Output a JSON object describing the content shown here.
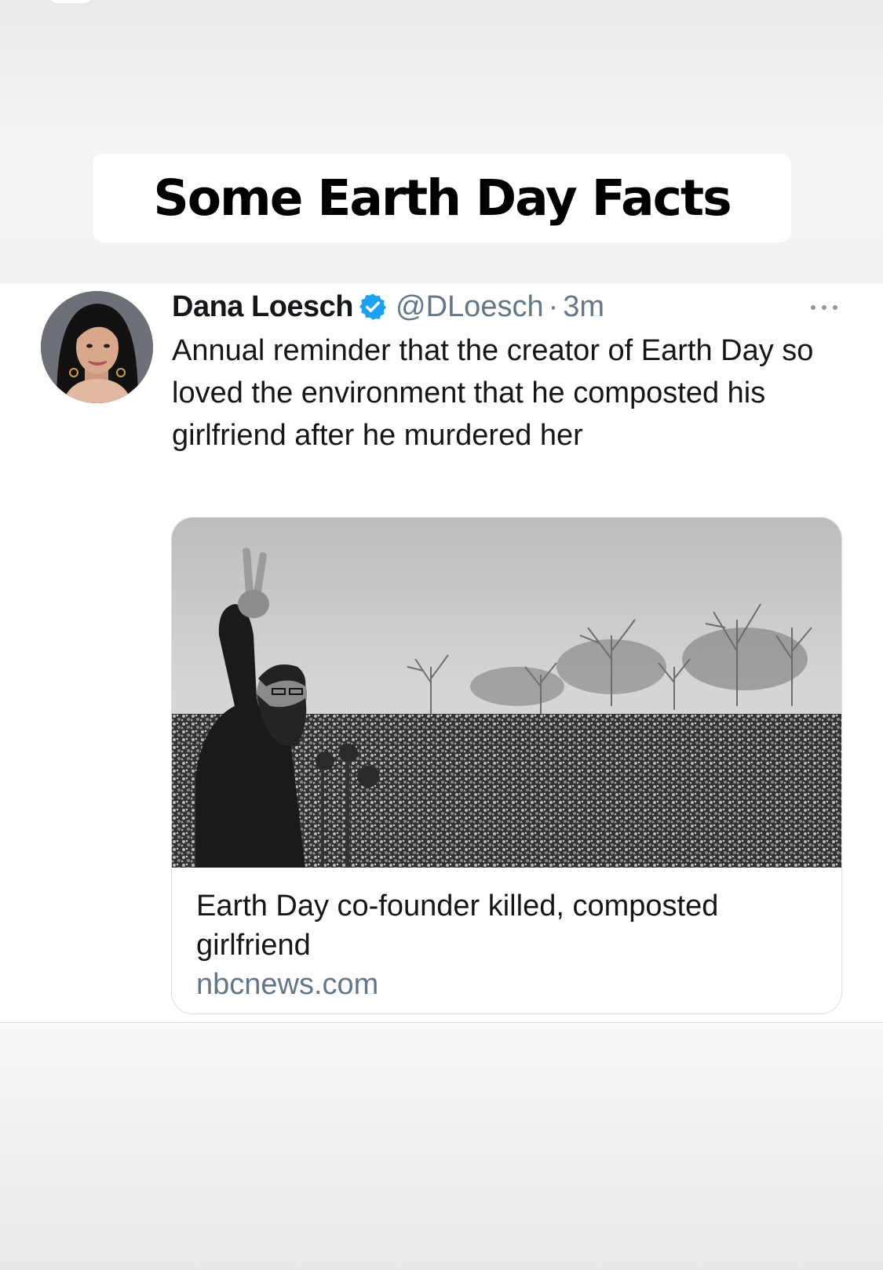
{
  "caption": {
    "text": "Some Earth Day Facts"
  },
  "tweet": {
    "author_name": "Dana Loesch",
    "verified": true,
    "handle": "@DLoesch",
    "separator": "·",
    "timestamp": "3m",
    "text": "Annual reminder that the creator of Earth Day so loved the environment that he composted his girlfriend after he murdered her",
    "link_card": {
      "title": "Earth Day co-founder killed, composted girlfriend",
      "domain": "nbcnews.com",
      "image": "black-and-white photo of a man raising a peace sign before a large crowd"
    },
    "more_icon": "ellipsis-icon"
  },
  "colors": {
    "verified_blue": "#1da1f2",
    "secondary_text": "#657786",
    "primary_text": "#14171a"
  }
}
